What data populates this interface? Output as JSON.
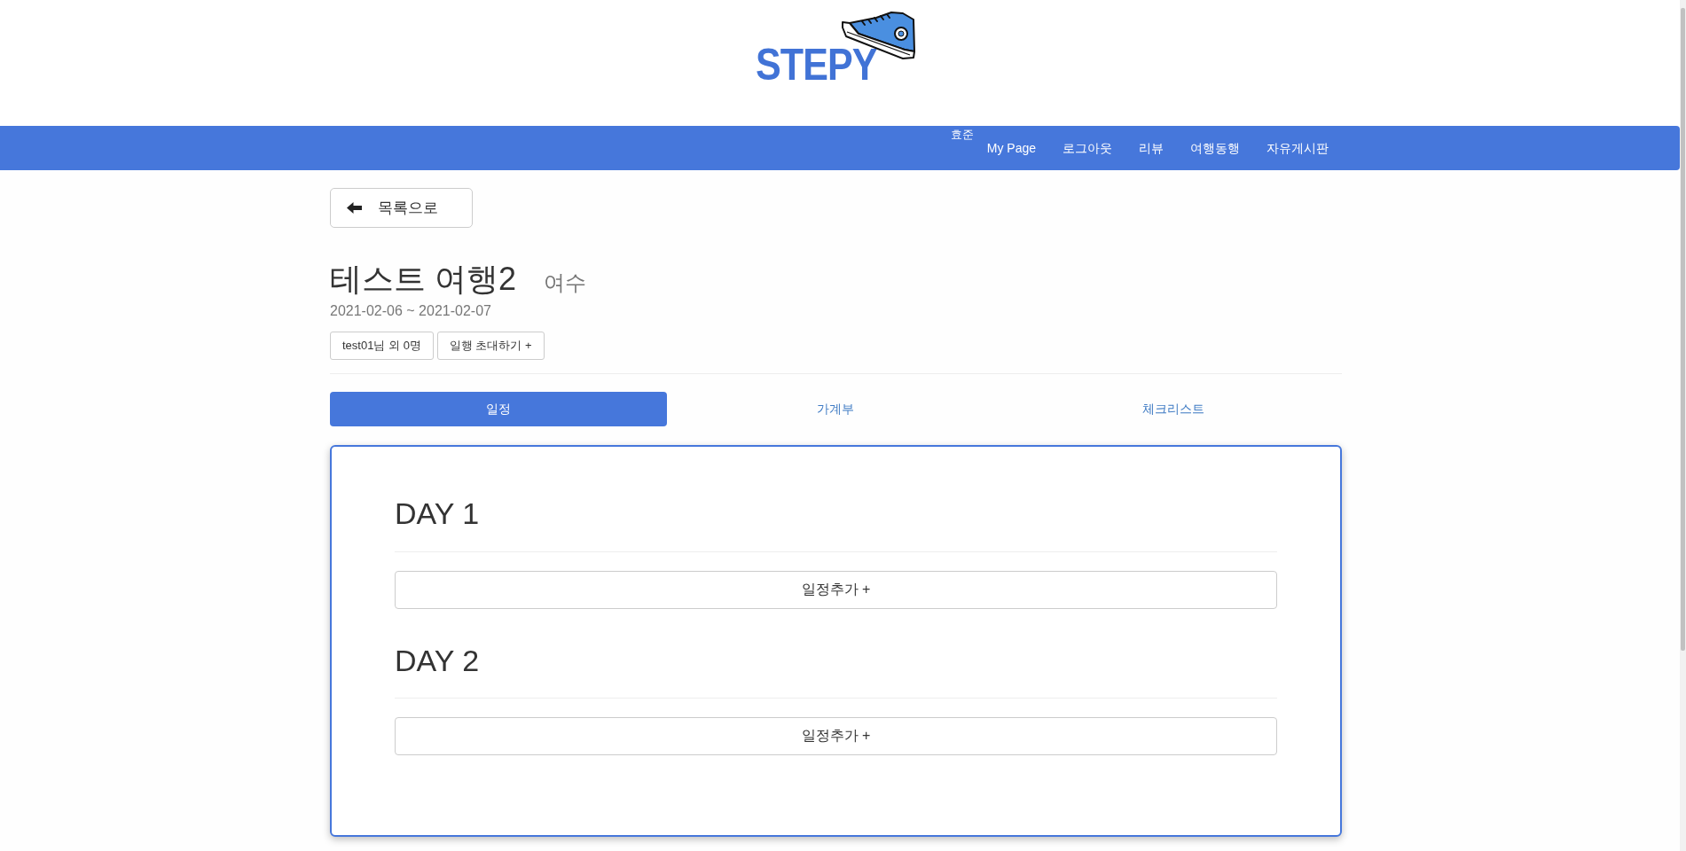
{
  "logo": {
    "text": "STEPY"
  },
  "nav": {
    "user": "효준",
    "links": [
      "My Page",
      "로그아웃",
      "리뷰",
      "여행동행",
      "자유게시판"
    ]
  },
  "back_button": {
    "label": "목록으로"
  },
  "trip": {
    "title": "테스트 여행2",
    "location": "여수",
    "dates": "2021-02-06 ~ 2021-02-07",
    "members_button": "test01님 외 0명",
    "invite_button": "일행 초대하기 +"
  },
  "tabs": [
    {
      "label": "일정",
      "selected": true
    },
    {
      "label": "가계부",
      "selected": false
    },
    {
      "label": "체크리스트",
      "selected": false
    }
  ],
  "schedule": {
    "days": [
      {
        "title": "DAY 1",
        "add_button": "일정추가 +"
      },
      {
        "title": "DAY 2",
        "add_button": "일정추가 +"
      }
    ]
  }
}
